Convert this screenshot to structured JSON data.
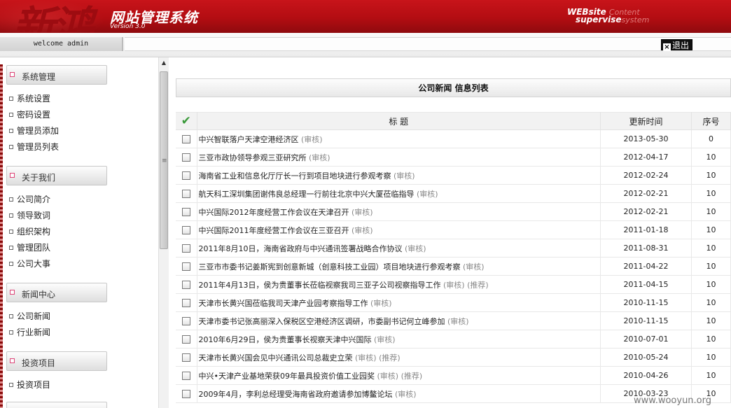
{
  "header": {
    "deco": "新鸿",
    "title": "网站管理系统",
    "version": "Version 3.0",
    "logo_line1": "WEBsite",
    "logo_line1_faded": "Content",
    "logo_line2": "supervise",
    "logo_line2_faded": "system"
  },
  "topbar": {
    "welcome": "welcome admin",
    "logout": "退出"
  },
  "sidebar": {
    "groups": [
      {
        "label": "系统管理",
        "items": [
          "系统设置",
          "密码设置",
          "管理员添加",
          "管理员列表"
        ]
      },
      {
        "label": "关于我们",
        "items": [
          "公司简介",
          "领导致词",
          "组织架构",
          "管理团队",
          "公司大事"
        ]
      },
      {
        "label": "新闻中心",
        "items": [
          "公司新闻",
          "行业新闻"
        ]
      },
      {
        "label": "投资项目",
        "items": [
          "投资项目"
        ]
      }
    ]
  },
  "main": {
    "list_title": "公司新闻 信息列表",
    "columns": {
      "title": "标 题",
      "date": "更新时间",
      "order": "序号"
    },
    "rows": [
      {
        "title": "中兴智联落户天津空港经济区",
        "tags": "(审核)",
        "date": "2013-05-30",
        "order": "0"
      },
      {
        "title": "三亚市政协领导参观三亚研究所",
        "tags": "(审核)",
        "date": "2012-04-17",
        "order": "10"
      },
      {
        "title": "海南省工业和信息化厅厅长一行到项目地块进行参观考察",
        "tags": "(审核)",
        "date": "2012-02-24",
        "order": "10"
      },
      {
        "title": "航天科工深圳集团谢伟良总经理一行前往北京中兴大厦莅临指导",
        "tags": "(审核)",
        "date": "2012-02-21",
        "order": "10"
      },
      {
        "title": "中兴国际2012年度经营工作会议在天津召开",
        "tags": "(审核)",
        "date": "2012-02-21",
        "order": "10"
      },
      {
        "title": "中兴国际2011年度经营工作会议在三亚召开",
        "tags": "(审核)",
        "date": "2011-01-18",
        "order": "10"
      },
      {
        "title": "2011年8月10日，海南省政府与中兴通讯签署战略合作协议",
        "tags": "(审核)",
        "date": "2011-08-31",
        "order": "10"
      },
      {
        "title": "三亚市市委书记姜斯宪到创意新城（创意科技工业园）项目地块进行参观考察",
        "tags": "(审核)",
        "date": "2011-04-22",
        "order": "10"
      },
      {
        "title": "2011年4月13日，侯为贵董事长莅临视察我司三亚子公司视察指导工作",
        "tags": "(审核) (推荐)",
        "date": "2011-04-15",
        "order": "10"
      },
      {
        "title": "天津市长黄兴国莅临我司天津产业园考察指导工作",
        "tags": "(审核)",
        "date": "2010-11-15",
        "order": "10"
      },
      {
        "title": "天津市委书记张高丽深入保税区空港经济区调研，市委副书记何立峰参加",
        "tags": "(审核)",
        "date": "2010-11-15",
        "order": "10"
      },
      {
        "title": "2010年6月29日，侯为贵董事长视察天津中兴国际",
        "tags": "(审核)",
        "date": "2010-07-01",
        "order": "10"
      },
      {
        "title": "天津市长黄兴国会见中兴通讯公司总裁史立荣",
        "tags": "(审核) (推荐)",
        "date": "2010-05-24",
        "order": "10"
      },
      {
        "title": "中兴•天津产业基地荣获09年最具投资价值工业园奖",
        "tags": "(审核) (推荐)",
        "date": "2010-04-26",
        "order": "10"
      },
      {
        "title": "2009年4月，李利总经理受海南省政府邀请参加博鳌论坛",
        "tags": "(审核)",
        "date": "2010-03-23",
        "order": "10"
      }
    ]
  },
  "watermark": "www.wooyun.org",
  "colors": {
    "header_red": "#b30d12",
    "check_green": "#3a9a3a"
  }
}
